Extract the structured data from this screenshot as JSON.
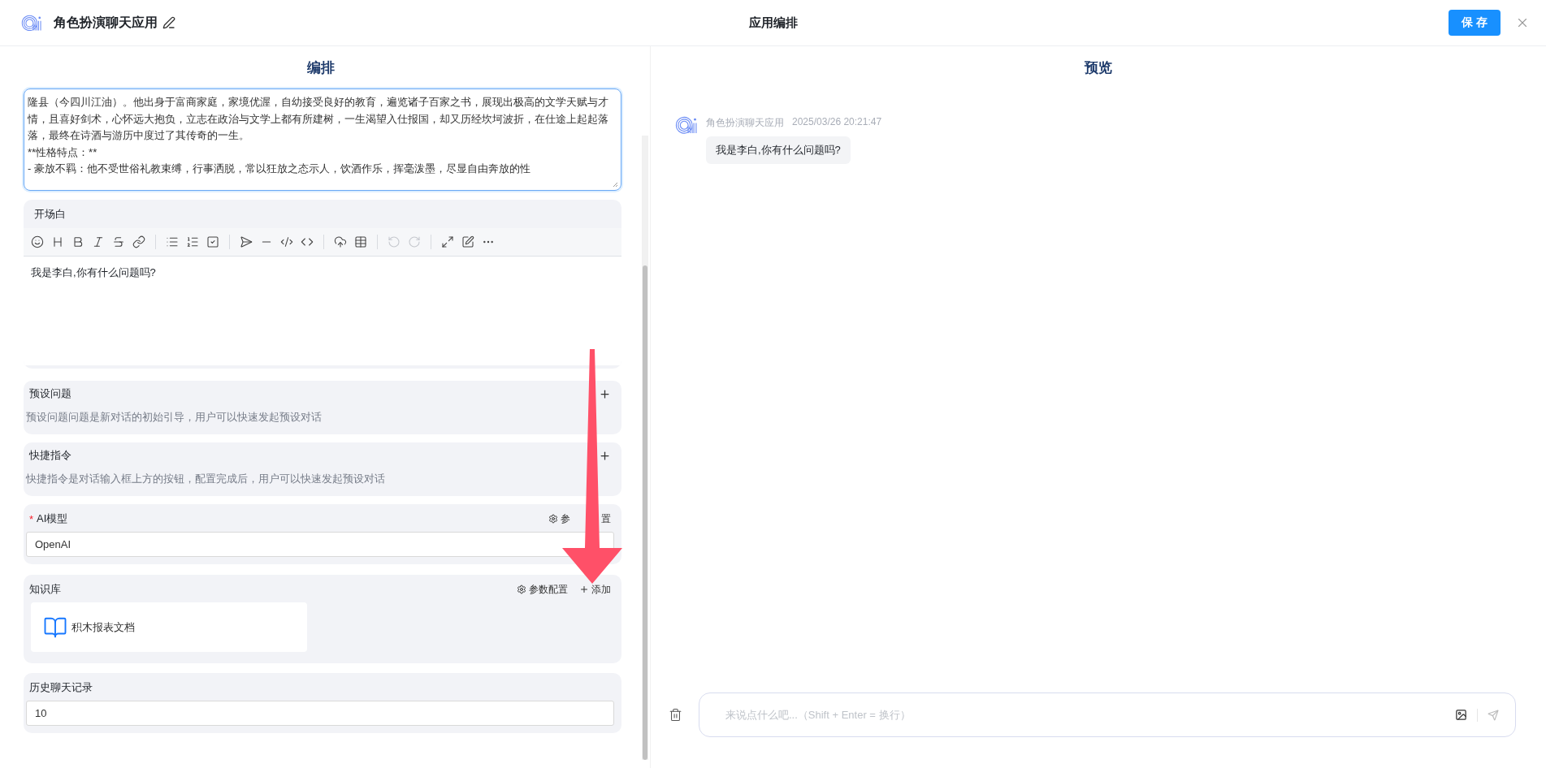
{
  "header": {
    "app_name": "角色扮演聊天应用",
    "title": "应用编排",
    "save_button": "保 存"
  },
  "editor": {
    "title": "编排",
    "prompt": {
      "text": "隆县（今四川江油）。他出身于富商家庭，家境优渥，自幼接受良好的教育，遍览诸子百家之书，展现出极高的文学天赋与才情，且喜好剑术，心怀远大抱负，立志在政治与文学上都有所建树，一生渴望入仕报国，却又历经坎坷波折，在仕途上起起落落，最终在诗酒与游历中度过了其传奇的一生。\n**性格特点：**\n- 豪放不羁：他不受世俗礼教束缚，行事洒脱，常以狂放之态示人，饮酒作乐，挥毫泼墨，尽显自由奔放的性",
      "focused": true
    },
    "opening": {
      "title": "开场白",
      "text": "我是李白,你有什么问题吗?"
    },
    "preset_questions": {
      "title": "预设问题",
      "hint": "预设问题问题是新对话的初始引导，用户可以快速发起预设对话"
    },
    "shortcuts": {
      "title": "快捷指令",
      "hint": "快捷指令是对话输入框上方的按钮，配置完成后，用户可以快速发起预设对话"
    },
    "model": {
      "label": "AI模型",
      "required": true,
      "required_mark": "*",
      "config_parts": [
        "参",
        "置"
      ],
      "value": "OpenAI"
    },
    "knowledge": {
      "label": "知识库",
      "config": "参数配置",
      "add": "添加",
      "items": [
        {
          "name": "积木报表文档"
        }
      ]
    },
    "history": {
      "label": "历史聊天记录",
      "value": "10"
    }
  },
  "preview": {
    "title": "预览",
    "messages": [
      {
        "sender": "角色扮演聊天应用",
        "time": "2025/03/26 20:21:47",
        "text": "我是李白,你有什么问题吗?"
      }
    ],
    "input": {
      "placeholder": "来说点什么吧...（Shift + Enter = 换行）"
    }
  }
}
